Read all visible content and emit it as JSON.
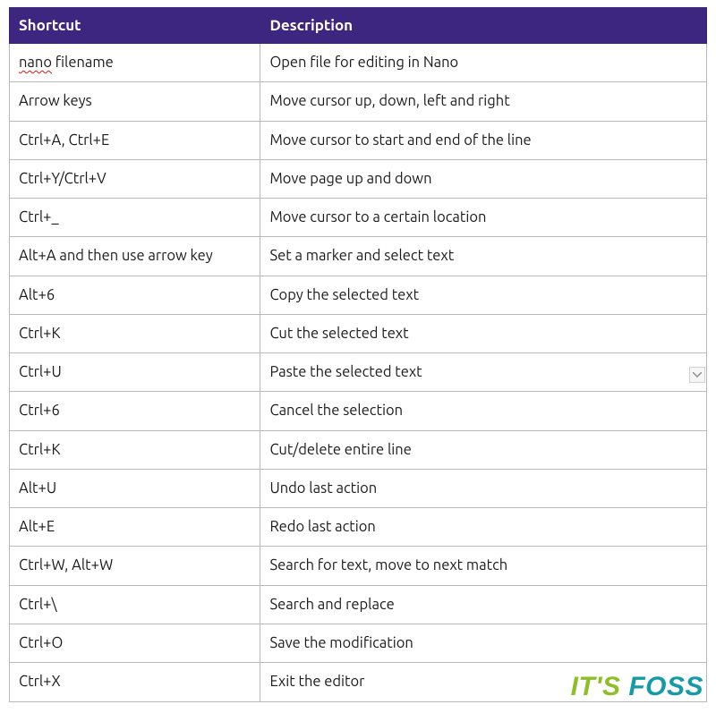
{
  "table": {
    "headers": {
      "shortcut": "Shortcut",
      "description": "Description"
    },
    "rows": [
      {
        "shortcut_prefix": "nano",
        "shortcut_rest": " filename",
        "description": "Open file for editing in Nano"
      },
      {
        "shortcut": "Arrow keys",
        "description": "Move cursor up, down, left and right"
      },
      {
        "shortcut": "Ctrl+A, Ctrl+E",
        "description": "Move cursor to start and end of the line"
      },
      {
        "shortcut": "Ctrl+Y/Ctrl+V",
        "description": "Move page up and down"
      },
      {
        "shortcut": "Ctrl+_",
        "description": "Move cursor to a certain location"
      },
      {
        "shortcut": "Alt+A and then use arrow key",
        "description": "Set a marker and select text"
      },
      {
        "shortcut": "Alt+6",
        "description": "Copy the selected text"
      },
      {
        "shortcut": "Ctrl+K",
        "description": "Cut the selected text"
      },
      {
        "shortcut": "Ctrl+U",
        "description": "Paste the selected text"
      },
      {
        "shortcut": "Ctrl+6",
        "description": "Cancel the selection"
      },
      {
        "shortcut": "Ctrl+K",
        "description": "Cut/delete entire line"
      },
      {
        "shortcut": "Alt+U",
        "description": "Undo last action"
      },
      {
        "shortcut": "Alt+E",
        "description": "Redo last action"
      },
      {
        "shortcut": "Ctrl+W, Alt+W",
        "description": "Search for text, move to next match"
      },
      {
        "shortcut": "Ctrl+\\",
        "description": "Search and replace"
      },
      {
        "shortcut": "Ctrl+O",
        "description": "Save the modification"
      },
      {
        "shortcut": "Ctrl+X",
        "description": "Exit the editor"
      }
    ]
  },
  "watermark": {
    "its": "IT'S ",
    "foss": "FOSS"
  }
}
